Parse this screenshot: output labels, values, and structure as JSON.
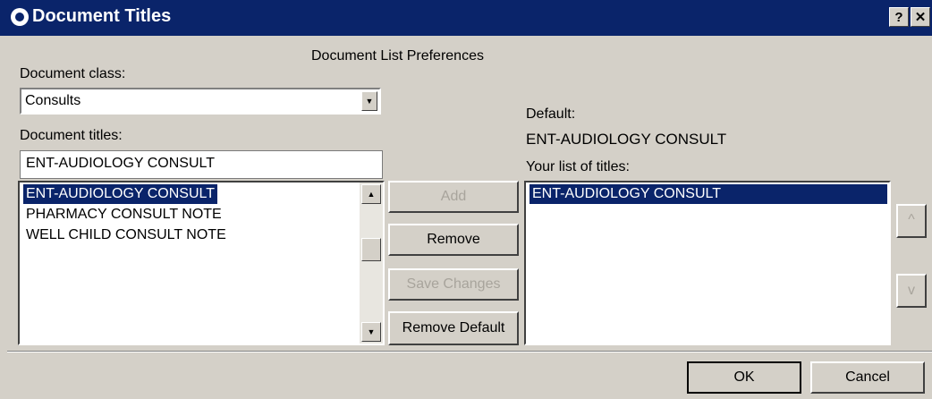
{
  "window": {
    "title": "Document Titles",
    "help_label": "?",
    "close_label": "✕"
  },
  "header": {
    "title": "Document List Preferences"
  },
  "document_class": {
    "label": "Document class:",
    "value": "Consults"
  },
  "document_titles": {
    "label": "Document titles:",
    "search_value": "ENT-AUDIOLOGY CONSULT",
    "items": [
      "ENT-AUDIOLOGY CONSULT",
      "PHARMACY CONSULT NOTE",
      "WELL CHILD CONSULT NOTE"
    ]
  },
  "buttons": {
    "add": "Add",
    "remove": "Remove",
    "save_changes": "Save Changes",
    "remove_default": "Remove Default",
    "move_up": "^",
    "move_down": "v",
    "ok": "OK",
    "cancel": "Cancel"
  },
  "default": {
    "label": "Default:",
    "value": "ENT-AUDIOLOGY CONSULT"
  },
  "your_list": {
    "label": "Your list of titles:",
    "items": [
      "ENT-AUDIOLOGY CONSULT"
    ]
  },
  "icons": {
    "title": "app-logo-icon",
    "scroll_up": "arrow-up-icon",
    "scroll_down": "arrow-down-icon",
    "dropdown": "chevron-down-icon"
  },
  "colors": {
    "titlebar": "#0a246a",
    "dialog": "#d4d0c8",
    "selection": "#0a246a"
  }
}
